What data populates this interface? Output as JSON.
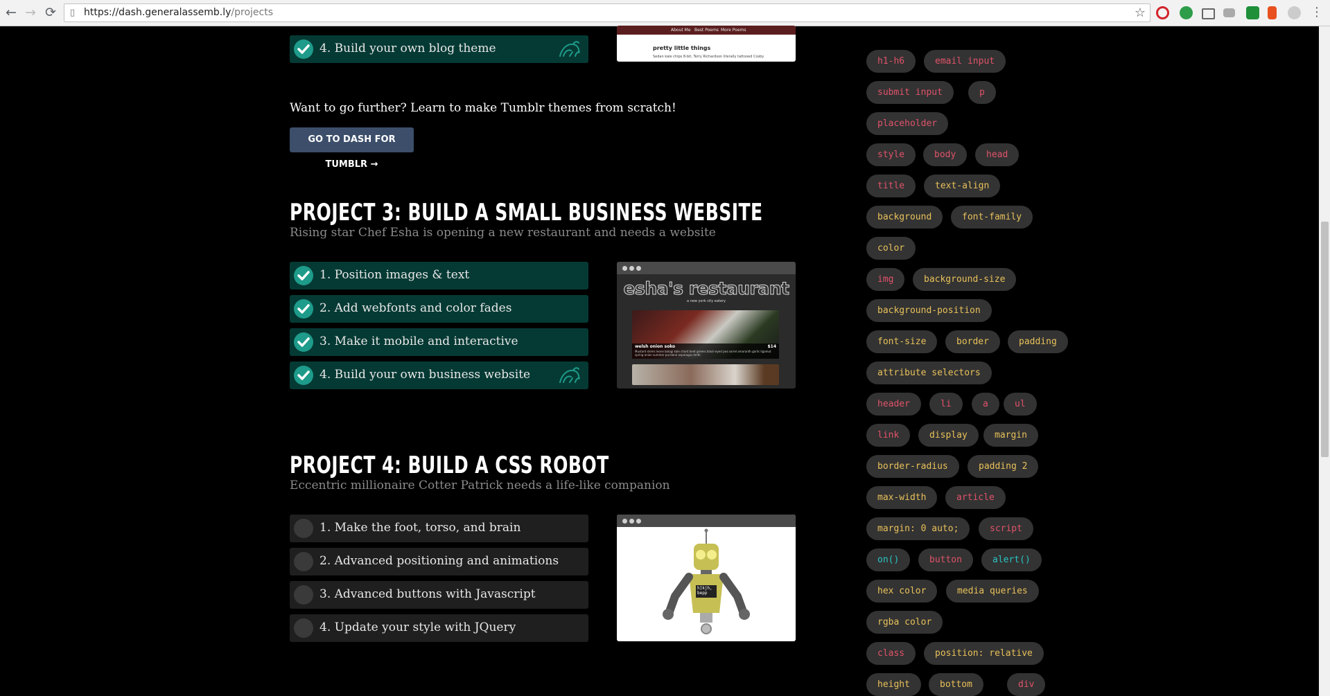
{
  "browser": {
    "url_host": "https://dash.generalassemb.ly",
    "url_path": "/projects"
  },
  "project2": {
    "last_task": "4. Build your own blog theme",
    "thumb_nav": [
      "About Me",
      "Best Poems",
      "More Poems"
    ],
    "thumb_post_title": "pretty little things",
    "thumb_post_text": "Sedan kale chips 8-bit, Terry Richardson literally tattooed Cosby"
  },
  "promo": {
    "text": "Want to go further? Learn to make Tumblr themes from scratch!",
    "button": "GO TO DASH FOR TUMBLR →"
  },
  "project3": {
    "title": "PROJECT 3: BUILD A SMALL BUSINESS WEBSITE",
    "subtitle": "Rising star Chef Esha is opening a new restaurant and needs a website",
    "tasks": [
      "1. Position images & text",
      "2. Add webfonts and color fades",
      "3. Make it mobile and interactive",
      "4. Build your own business website"
    ],
    "thumb_title": "esha's restaurant",
    "thumb_tagline": "a new york city eatery",
    "thumb_dish": "welsh onion soko",
    "thumb_price": "$14",
    "thumb_desc": "Mustard stems leone bologi kale chard beet greens black-eyed pea sorrel amaranth garlic ligamut spring onion summer purslane asparagus lentil."
  },
  "project4": {
    "title": "PROJECT 4: BUILD A CSS ROBOT",
    "subtitle": "Eccentric millionaire Cotter Patrick needs a life-like companion",
    "tasks": [
      "1. Make the foot, torso, and brain",
      "2. Advanced positioning and animations",
      "3. Advanced buttons with Javascript",
      "4. Update your style with JQuery"
    ],
    "robot_screen": "h]kjh, bepp"
  },
  "tags": [
    {
      "label": "h1-h6",
      "color": "red"
    },
    {
      "label": "email input",
      "color": "red"
    },
    {
      "label": "submit input",
      "color": "red"
    },
    {
      "label": "p",
      "color": "red"
    },
    {
      "label": "placeholder",
      "color": "red"
    },
    {
      "label": "style",
      "color": "red"
    },
    {
      "label": "body",
      "color": "red"
    },
    {
      "label": "head",
      "color": "red"
    },
    {
      "label": "title",
      "color": "red"
    },
    {
      "label": "text-align",
      "color": "yellow"
    },
    {
      "label": "background",
      "color": "yellow"
    },
    {
      "label": "font-family",
      "color": "yellow"
    },
    {
      "label": "color",
      "color": "yellow"
    },
    {
      "label": "img",
      "color": "red"
    },
    {
      "label": "background-size",
      "color": "yellow"
    },
    {
      "label": "background-position",
      "color": "yellow"
    },
    {
      "label": "font-size",
      "color": "yellow"
    },
    {
      "label": "border",
      "color": "yellow"
    },
    {
      "label": "padding",
      "color": "yellow"
    },
    {
      "label": "attribute selectors",
      "color": "yellow"
    },
    {
      "label": "header",
      "color": "red"
    },
    {
      "label": "li",
      "color": "red"
    },
    {
      "label": "a",
      "color": "red"
    },
    {
      "label": "ul",
      "color": "red"
    },
    {
      "label": "link",
      "color": "red"
    },
    {
      "label": "display",
      "color": "yellow"
    },
    {
      "label": "margin",
      "color": "yellow"
    },
    {
      "label": "border-radius",
      "color": "yellow"
    },
    {
      "label": "padding 2",
      "color": "yellow"
    },
    {
      "label": "max-width",
      "color": "yellow"
    },
    {
      "label": "article",
      "color": "red"
    },
    {
      "label": "margin: 0 auto;",
      "color": "yellow"
    },
    {
      "label": "script",
      "color": "red"
    },
    {
      "label": "on()",
      "color": "teal"
    },
    {
      "label": "button",
      "color": "red"
    },
    {
      "label": "alert()",
      "color": "teal"
    },
    {
      "label": "hex color",
      "color": "yellow"
    },
    {
      "label": "media queries",
      "color": "yellow"
    },
    {
      "label": "rgba color",
      "color": "yellow"
    },
    {
      "label": "class",
      "color": "red"
    },
    {
      "label": "position: relative",
      "color": "yellow"
    },
    {
      "label": "height",
      "color": "yellow"
    },
    {
      "label": "bottom",
      "color": "yellow"
    },
    {
      "label": "div",
      "color": "red"
    }
  ],
  "colors": {
    "tag_red": "#e0536a",
    "tag_yellow": "#e8c15a",
    "tag_teal": "#2ac4c4",
    "task_done_bg": "#053a34",
    "check_teal": "#1e9b8a",
    "button_bg": "#3c4e6a"
  }
}
